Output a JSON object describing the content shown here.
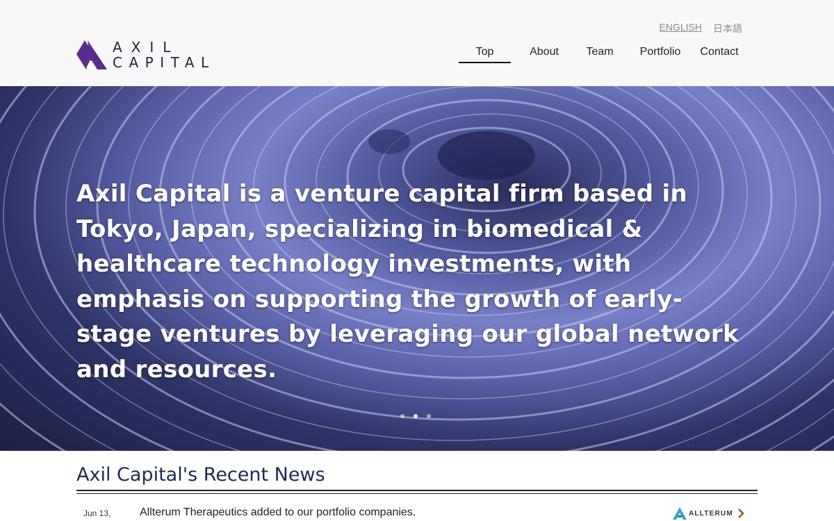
{
  "header": {
    "logo": {
      "line1": "AXIL",
      "line2": "CAPITAL",
      "brand_color": "#5b2a8c"
    },
    "languages": [
      {
        "label": "ENGLISH",
        "active": true
      },
      {
        "label": "日本語",
        "active": false
      }
    ],
    "nav": [
      {
        "label": "Top",
        "active": true
      },
      {
        "label": "About"
      },
      {
        "label": "Team"
      },
      {
        "label": "Portfolio"
      },
      {
        "label": "Contact"
      }
    ]
  },
  "hero": {
    "text": "Axil Capital is a venture capital firm based in Tokyo, Japan, specializing in biomedical & healthcare technology investments, with emphasis on supporting the growth of early-stage ventures by leveraging our global network and resources.",
    "slides": 3,
    "active_slide": 2
  },
  "news": {
    "title": "Axil Capital's Recent News",
    "items": [
      {
        "date": "Jun 13,",
        "text": "Allterum Therapeutics added to our portfolio companies.",
        "logo": "ALLTERUM",
        "icon": "chevron-right-icon"
      }
    ]
  },
  "colors": {
    "accent": "#1c2a56",
    "hero_tint": "#6a72bd"
  }
}
